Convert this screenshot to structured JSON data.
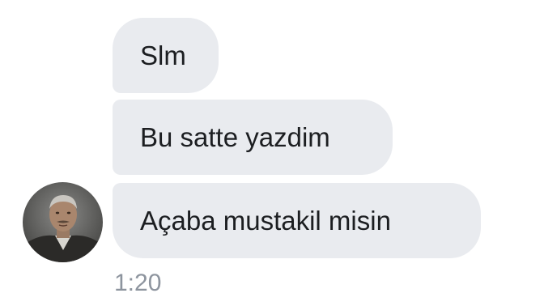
{
  "messages": [
    {
      "text": "Slm"
    },
    {
      "text": "Bu satte yazdim"
    },
    {
      "text": "Açaba mustakil misin"
    }
  ],
  "timestamp": "1:20",
  "icons": {
    "avatar": "person-photo-avatar"
  },
  "colors": {
    "bubble_bg": "#e9ebef",
    "text": "#1c1e21",
    "timestamp": "#8d949e",
    "background": "#ffffff"
  }
}
